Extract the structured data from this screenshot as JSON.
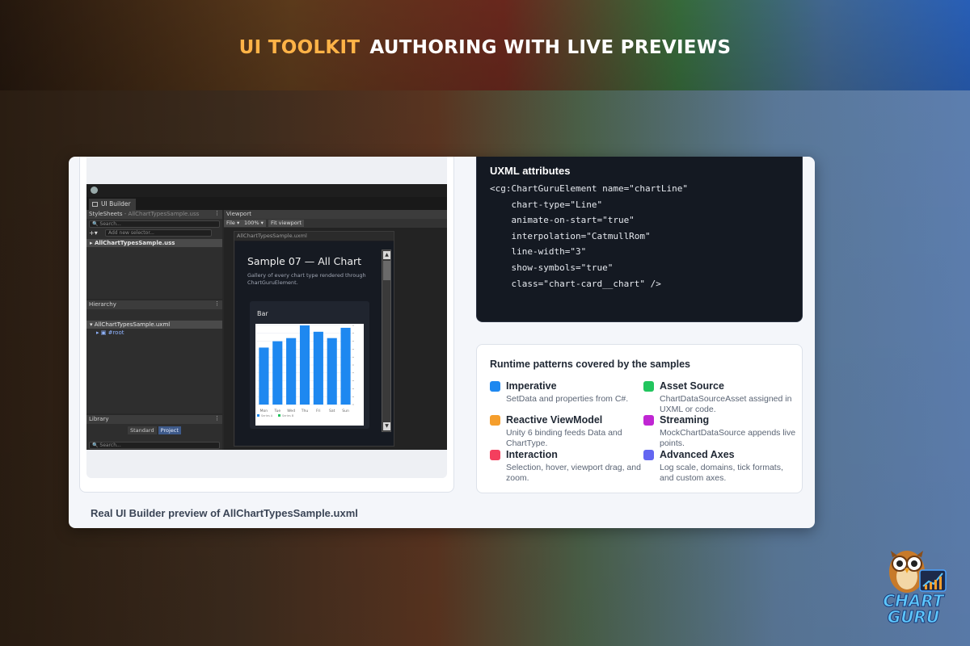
{
  "header": {
    "accent": "UI TOOLKIT",
    "title": "AUTHORING WITH LIVE PREVIEWS"
  },
  "colors": {
    "accent": "#ffb347",
    "chart_bar": "#1e88f0",
    "card_bg": "#f4f6fa",
    "code_bg": "#141922"
  },
  "editor": {
    "tab": "UI Builder",
    "stylesheets_label": "StyleSheets",
    "stylesheets_file": " - AllChartTypesSample.uss",
    "search_placeholder": "Search...",
    "add_selector": "Add new selector...",
    "selected_stylesheet": "AllChartTypesSample.uss",
    "hierarchy_label": "Hierarchy",
    "hierarchy_file": "AllChartTypesSample.uxml",
    "hierarchy_root": "#root",
    "library_label": "Library",
    "library_tabs": [
      "Standard",
      "Project"
    ],
    "viewport_label": "Viewport",
    "viewport_buttons": [
      "File ▾",
      "100% ▾",
      "Fit viewport"
    ],
    "doc_tab": "AllChartTypesSample.uxml",
    "doc_title": "Sample 07 — All Chart",
    "doc_subtitle": "Gallery of every chart type rendered through ChartGuruElement.",
    "chart_title": "Bar"
  },
  "chart_data": {
    "type": "bar",
    "title": "Bar",
    "categories": [
      "Mon",
      "Tue",
      "Wed",
      "Thu",
      "Fri",
      "Sat",
      "Sun"
    ],
    "values": [
      72,
      80,
      84,
      100,
      92,
      84,
      97
    ],
    "ylim": [
      0,
      100
    ],
    "legend": [
      "Series A",
      "Series B"
    ]
  },
  "caption": "Real UI Builder preview of AllChartTypesSample.uxml",
  "code": {
    "title": "UXML attributes",
    "lines": [
      "<cg:ChartGuruElement name=\"chartLine\"",
      "    chart-type=\"Line\"",
      "    animate-on-start=\"true\"",
      "    interpolation=\"CatmullRom\"",
      "    line-width=\"3\"",
      "    show-symbols=\"true\"",
      "    class=\"chart-card__chart\" />"
    ]
  },
  "runtime": {
    "title": "Runtime patterns covered by the samples",
    "items": [
      {
        "name": "Imperative",
        "desc": "SetData and properties from C#.",
        "color": "#1e88f0"
      },
      {
        "name": "Asset Source",
        "desc": "ChartDataSourceAsset assigned in UXML or code.",
        "color": "#22c55e"
      },
      {
        "name": "Reactive ViewModel",
        "desc": "Unity 6 binding feeds Data and ChartType.",
        "color": "#f59e2c"
      },
      {
        "name": "Streaming",
        "desc": "MockChartDataSource appends live points.",
        "color": "#c026d3"
      },
      {
        "name": "Interaction",
        "desc": "Selection, hover, viewport drag, and zoom.",
        "color": "#f43f5e"
      },
      {
        "name": "Advanced Axes",
        "desc": "Log scale, domains, tick formats, and custom axes.",
        "color": "#6366f1"
      }
    ]
  },
  "brand": {
    "word1": "CHART",
    "word2": "GURU"
  }
}
